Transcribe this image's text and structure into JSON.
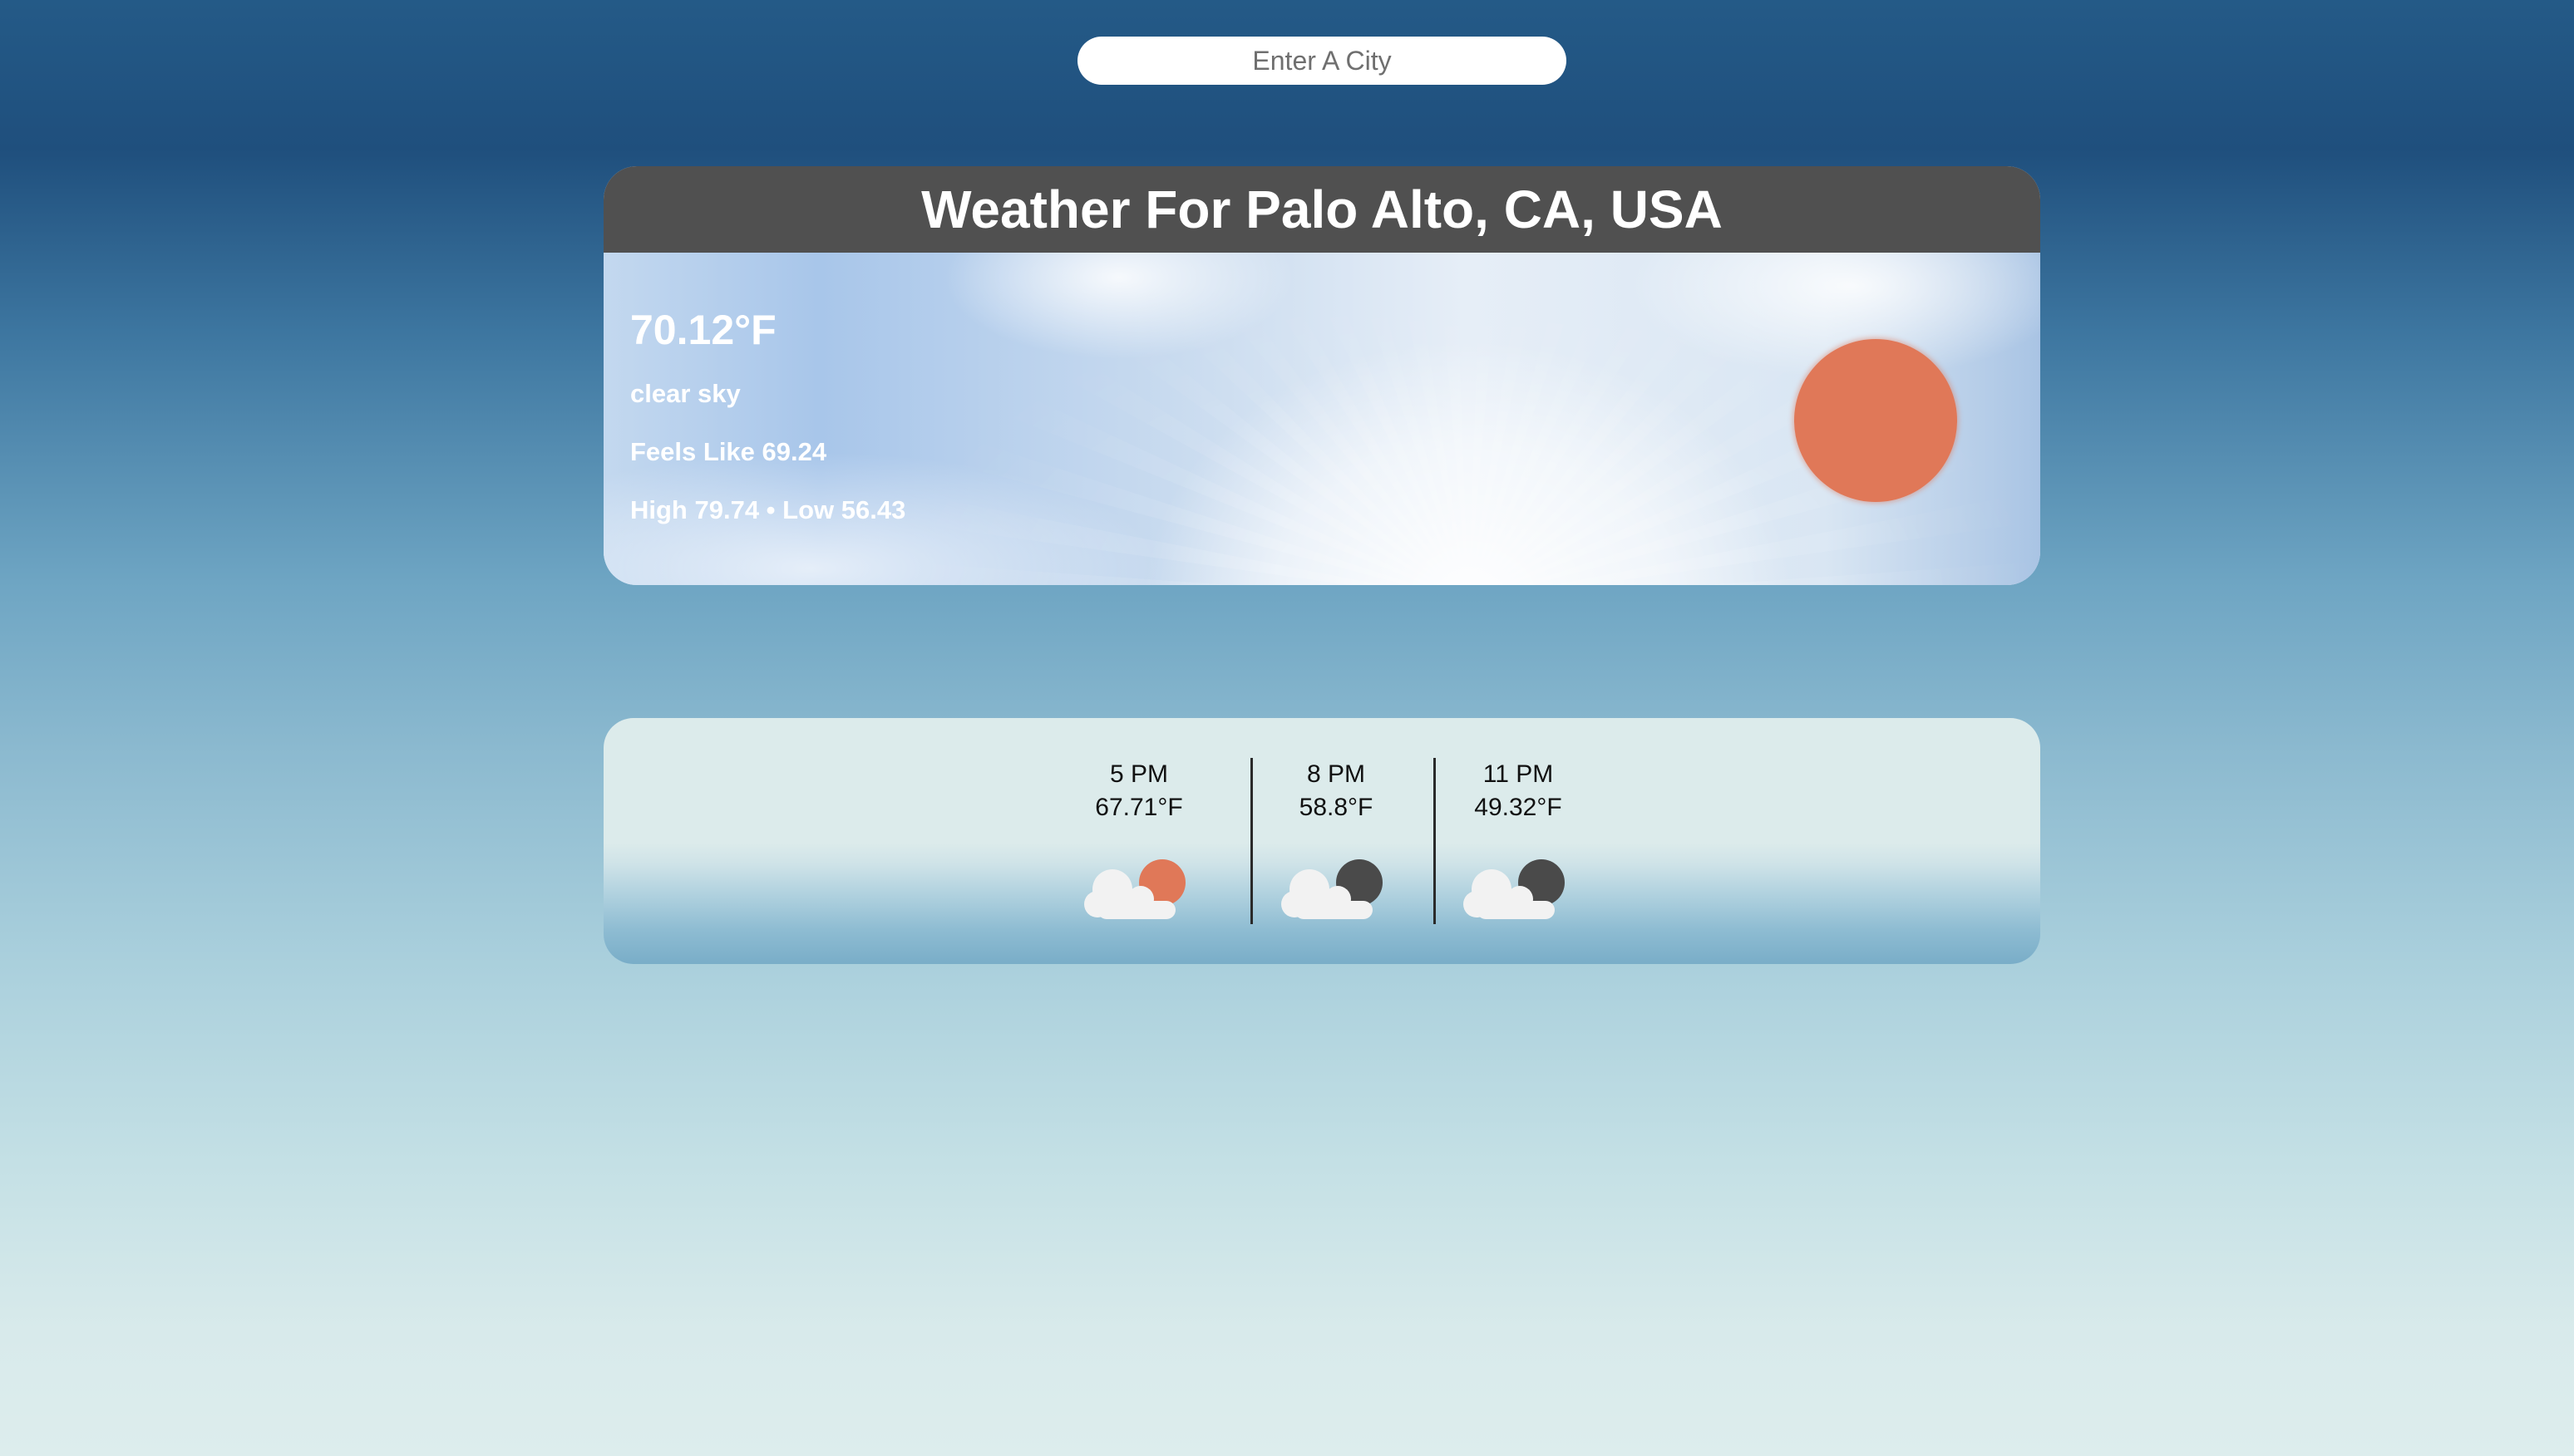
{
  "search": {
    "placeholder": "Enter A City"
  },
  "current": {
    "title": "Weather For Palo Alto, CA, USA",
    "temperature": "70.12°F",
    "description": "clear sky",
    "feels_like": "Feels Like 69.24",
    "high_low": "High 79.74 • Low 56.43",
    "icon": "sun-icon"
  },
  "forecast": [
    {
      "time": "5 PM",
      "temp": "67.71°F",
      "icon": "cloud-sun-icon"
    },
    {
      "time": "8 PM",
      "temp": "58.8°F",
      "icon": "cloud-moon-icon"
    },
    {
      "time": "11 PM",
      "temp": "49.32°F",
      "icon": "cloud-moon-icon"
    }
  ],
  "colors": {
    "header_bg": "#505050",
    "sun": "#e07858",
    "moon": "#4a4a4a",
    "cloud": "#f2f2f2"
  }
}
